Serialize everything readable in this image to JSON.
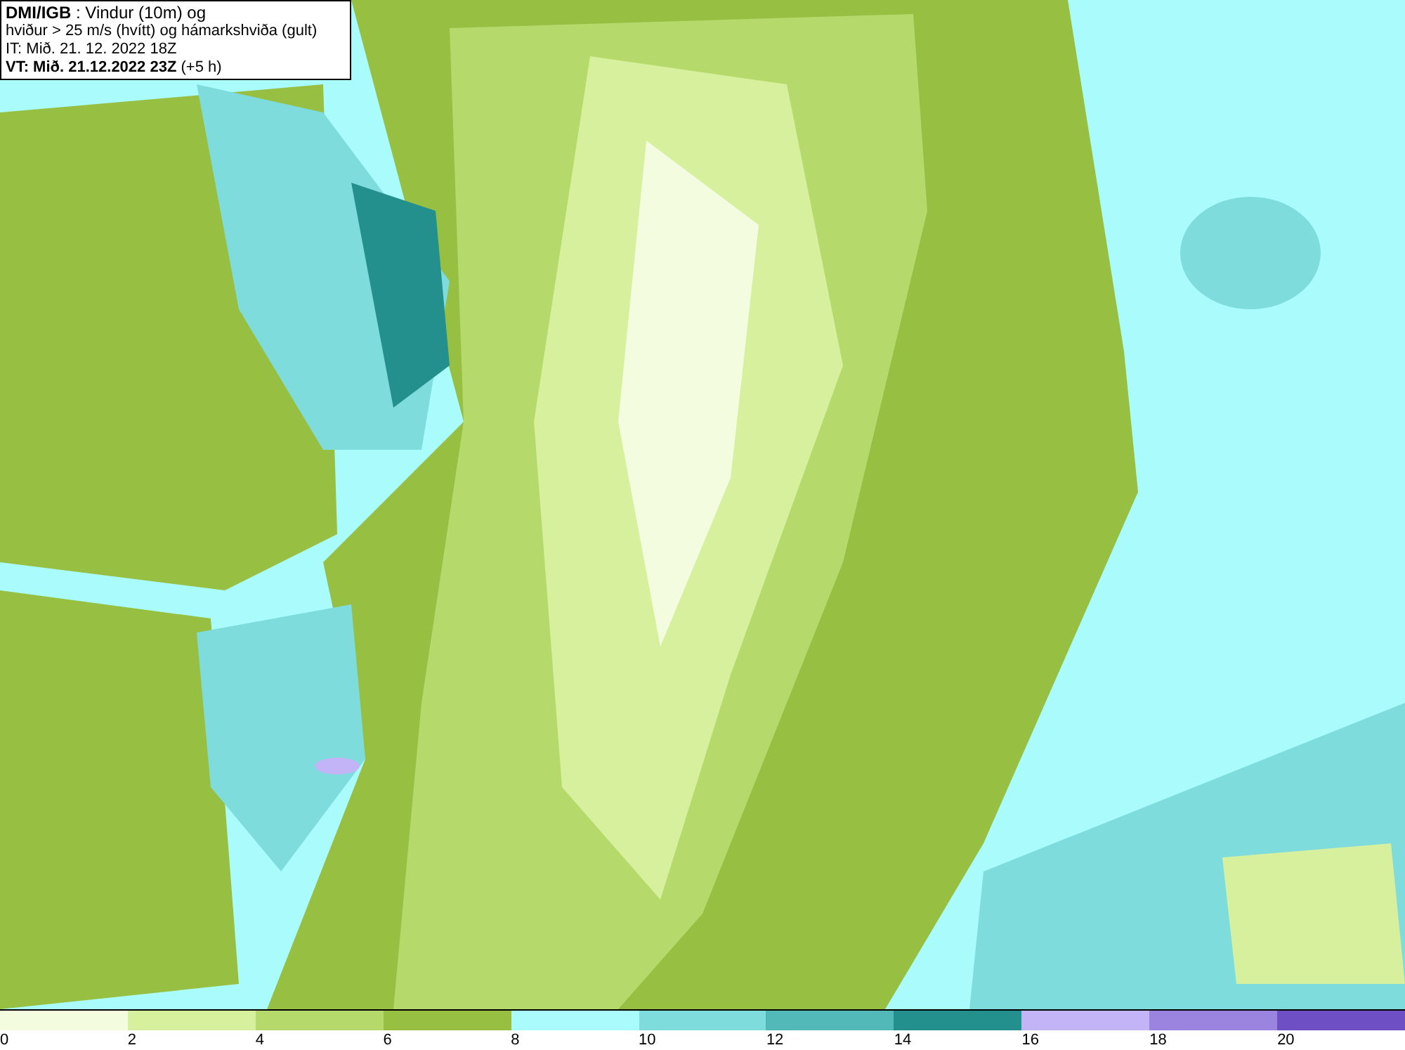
{
  "title_box": {
    "lines": [
      "**DMI/IGB** : Vindur (10m) og",
      "hviður > 25 m/s (hvítt) og hámarkshviða (gult)",
      "IT: Mið. 21. 12. 2022 18Z",
      "**VT: Mið. 21.12.2022 23Z** (+5 h)"
    ]
  },
  "legend": [
    {
      "label": "0",
      "color": "#f4fce0"
    },
    {
      "label": "2",
      "color": "#d6f09e"
    },
    {
      "label": "4",
      "color": "#b5d96b"
    },
    {
      "label": "6",
      "color": "#97c043"
    },
    {
      "label": "8",
      "color": "#aafcfc"
    },
    {
      "label": "10",
      "color": "#7fdcdc"
    },
    {
      "label": "12",
      "color": "#52b8b8"
    },
    {
      "label": "14",
      "color": "#24908e"
    },
    {
      "label": "16",
      "color": "#c2b4f6"
    },
    {
      "label": "18",
      "color": "#9b84e0"
    },
    {
      "label": "20",
      "color": "#6e4fc4"
    }
  ]
}
